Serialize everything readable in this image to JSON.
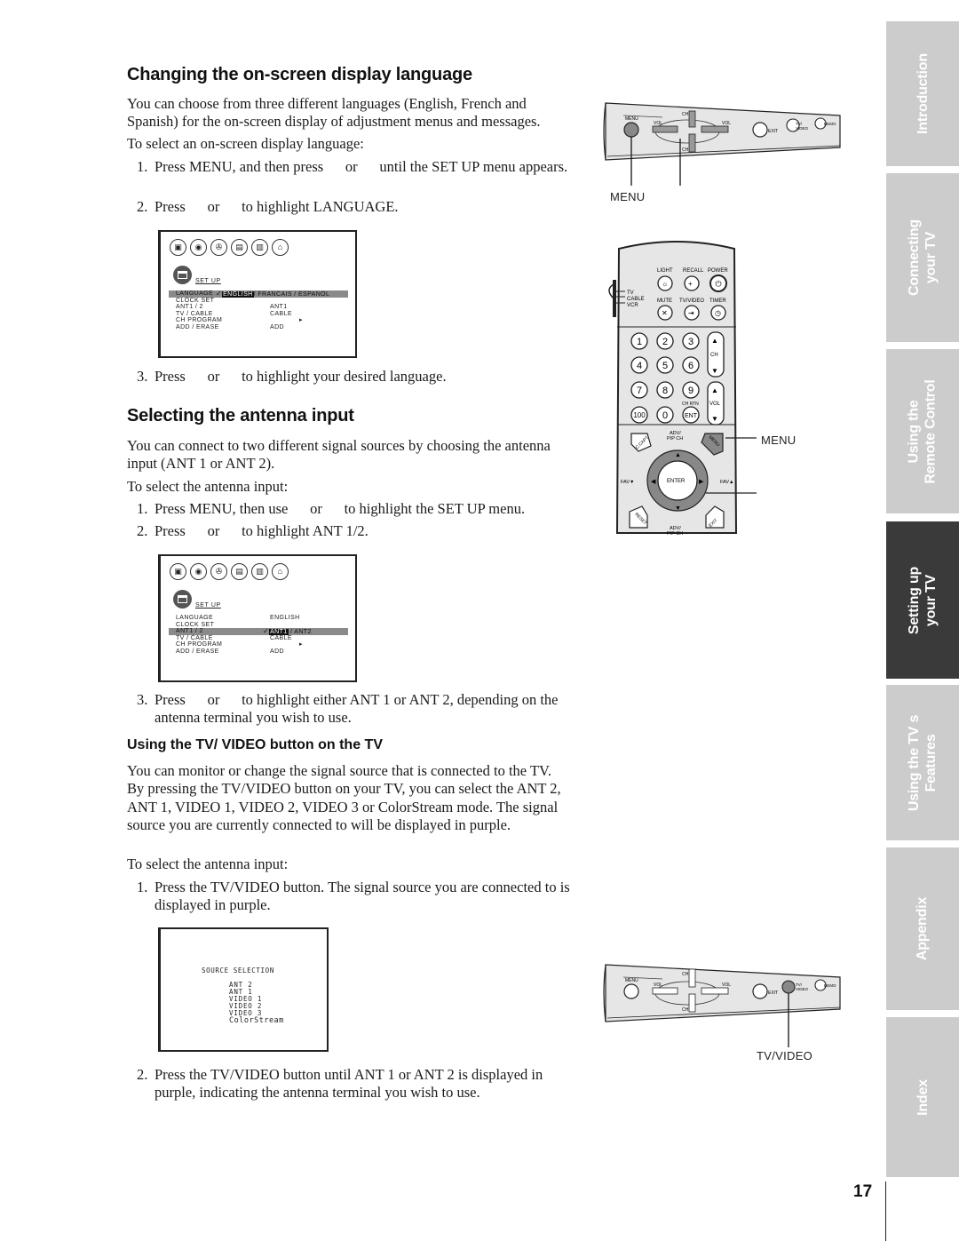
{
  "sections": {
    "language": {
      "heading": "Changing the on-screen display language",
      "intro": "You can choose from three different languages (English, French and Spanish) for the on-screen display of adjustment menus and messages.",
      "lead": "To select an on-screen display language:",
      "steps": [
        {
          "num": "1.",
          "text": "Press MENU, and then press      or      until the SET UP menu appears."
        },
        {
          "num": "2.",
          "text": "Press      or      to highlight LANGUAGE."
        },
        {
          "num": "3.",
          "text": "Press      or      to highlight your desired language."
        }
      ]
    },
    "antenna": {
      "heading": "Selecting the antenna input",
      "intro": "You can connect to two different signal sources by choosing the antenna input (ANT 1 or ANT 2).",
      "lead": "To select the antenna input:",
      "steps": [
        {
          "num": "1.",
          "text": "Press MENU, then use      or      to highlight the SET UP menu."
        },
        {
          "num": "2.",
          "text": "Press      or      to highlight ANT 1/2."
        },
        {
          "num": "3.",
          "text": "Press      or      to highlight either ANT 1 or ANT 2, depending on the antenna terminal you wish to use."
        }
      ]
    },
    "tvvideo": {
      "heading": "Using the TV/ VIDEO button on the TV",
      "intro": "You can monitor or change the signal source that is connected to the TV. By pressing the TV/VIDEO button on your TV, you can select the ANT 2, ANT 1, VIDEO 1, VIDEO 2, VIDEO 3 or ColorStream mode. The signal source you are currently connected to will be displayed in purple.",
      "lead": "To select the antenna input:",
      "steps": [
        {
          "num": "1.",
          "text": "Press the TV/VIDEO button. The signal source you are connected to is displayed in purple."
        },
        {
          "num": "2.",
          "text": "Press the TV/VIDEO button until ANT 1 or ANT 2 is displayed in purple, indicating the antenna terminal you wish to use."
        }
      ]
    }
  },
  "osd_language": {
    "menu_title": "SET UP",
    "icons": [
      "picture-icon",
      "audio-icon",
      "theater-icon",
      "setup-icon",
      "option-icon",
      "lock-icon"
    ],
    "rows": [
      {
        "label": "LANGUAGE",
        "value_selected": "ENGLISH",
        "value_rest": "/ FRANCAIS / ESPANOL",
        "highlight": true,
        "check": "✓"
      },
      {
        "label": "CLOCK  SET",
        "value": ""
      },
      {
        "label": "ANT1 / 2",
        "value": "ANT1"
      },
      {
        "label": "TV / CABLE",
        "value": "CABLE"
      },
      {
        "label": "CH  PROGRAM",
        "value": "",
        "arrow": "▸"
      },
      {
        "label": "ADD / ERASE",
        "value": "ADD"
      }
    ]
  },
  "osd_antenna": {
    "menu_title": "SET UP",
    "rows": [
      {
        "label": "LANGUAGE",
        "value": "ENGLISH"
      },
      {
        "label": "CLOCK  SET",
        "value": ""
      },
      {
        "label": "ANT1 / 2",
        "value_selected": "ANT1",
        "value_rest": "/ ANT2",
        "highlight": true,
        "check": "✓"
      },
      {
        "label": "TV / CABLE",
        "value": "CABLE"
      },
      {
        "label": "CH  PROGRAM",
        "value": "",
        "arrow": "▸"
      },
      {
        "label": "ADD / ERASE",
        "value": "ADD"
      }
    ]
  },
  "osd_source": {
    "title": "SOURCE SELECTION",
    "items": [
      "ANT  2",
      "ANT  1",
      "VIDEO  1",
      "VIDEO  2",
      "VIDEO  3",
      "ColorStream"
    ]
  },
  "tv_panel": {
    "labels": {
      "menu": "MENU",
      "vol_left": "VOL",
      "vol_right": "VOL",
      "ch_top": "CH",
      "ch_bottom": "CH",
      "exit": "EXIT",
      "tvvideo": "TV/ VIDEO",
      "demo": "DEMO"
    },
    "callout_top": "MENU",
    "callout_bottom": "TV/VIDEO"
  },
  "remote": {
    "switch": [
      "TV",
      "CABLE",
      "VCR"
    ],
    "top_labels": [
      "LIGHT",
      "RECALL",
      "POWER",
      "MUTE",
      "TV/VIDEO",
      "TIMER"
    ],
    "digits": [
      "1",
      "2",
      "3",
      "4",
      "5",
      "6",
      "7",
      "8",
      "9",
      "100",
      "0",
      "ENT"
    ],
    "ch_label": "CH",
    "vol_label": "VOL",
    "chrtn_label": "CH RTN",
    "nav": {
      "adv_top": "ADV/ PIP CH",
      "adv_bottom": "ADV/ PIP CH",
      "enter": "ENTER",
      "fav_left": "FAV▼",
      "fav_right": "FAV▲",
      "c_capt": "C.CAPT",
      "menu": "MENU",
      "reset": "RESET",
      "exit": "EXIT"
    },
    "callout": "MENU"
  },
  "side_tabs": [
    {
      "lines": [
        "Introduction"
      ],
      "active": false
    },
    {
      "lines": [
        "Connecting",
        "your TV"
      ],
      "active": false
    },
    {
      "lines": [
        "Using the",
        "Remote Control"
      ],
      "active": false
    },
    {
      "lines": [
        "Setting up",
        "your TV"
      ],
      "active": true
    },
    {
      "lines": [
        "Using the TV s",
        "Features"
      ],
      "active": false
    },
    {
      "lines": [
        "Appendix"
      ],
      "active": false
    },
    {
      "lines": [
        "Index"
      ],
      "active": false
    }
  ],
  "colors": {
    "tab_inactive": "#cccccc",
    "tab_active": "#3a3a3a",
    "panel_gray": "#e6e6e6"
  },
  "page_number": "17"
}
